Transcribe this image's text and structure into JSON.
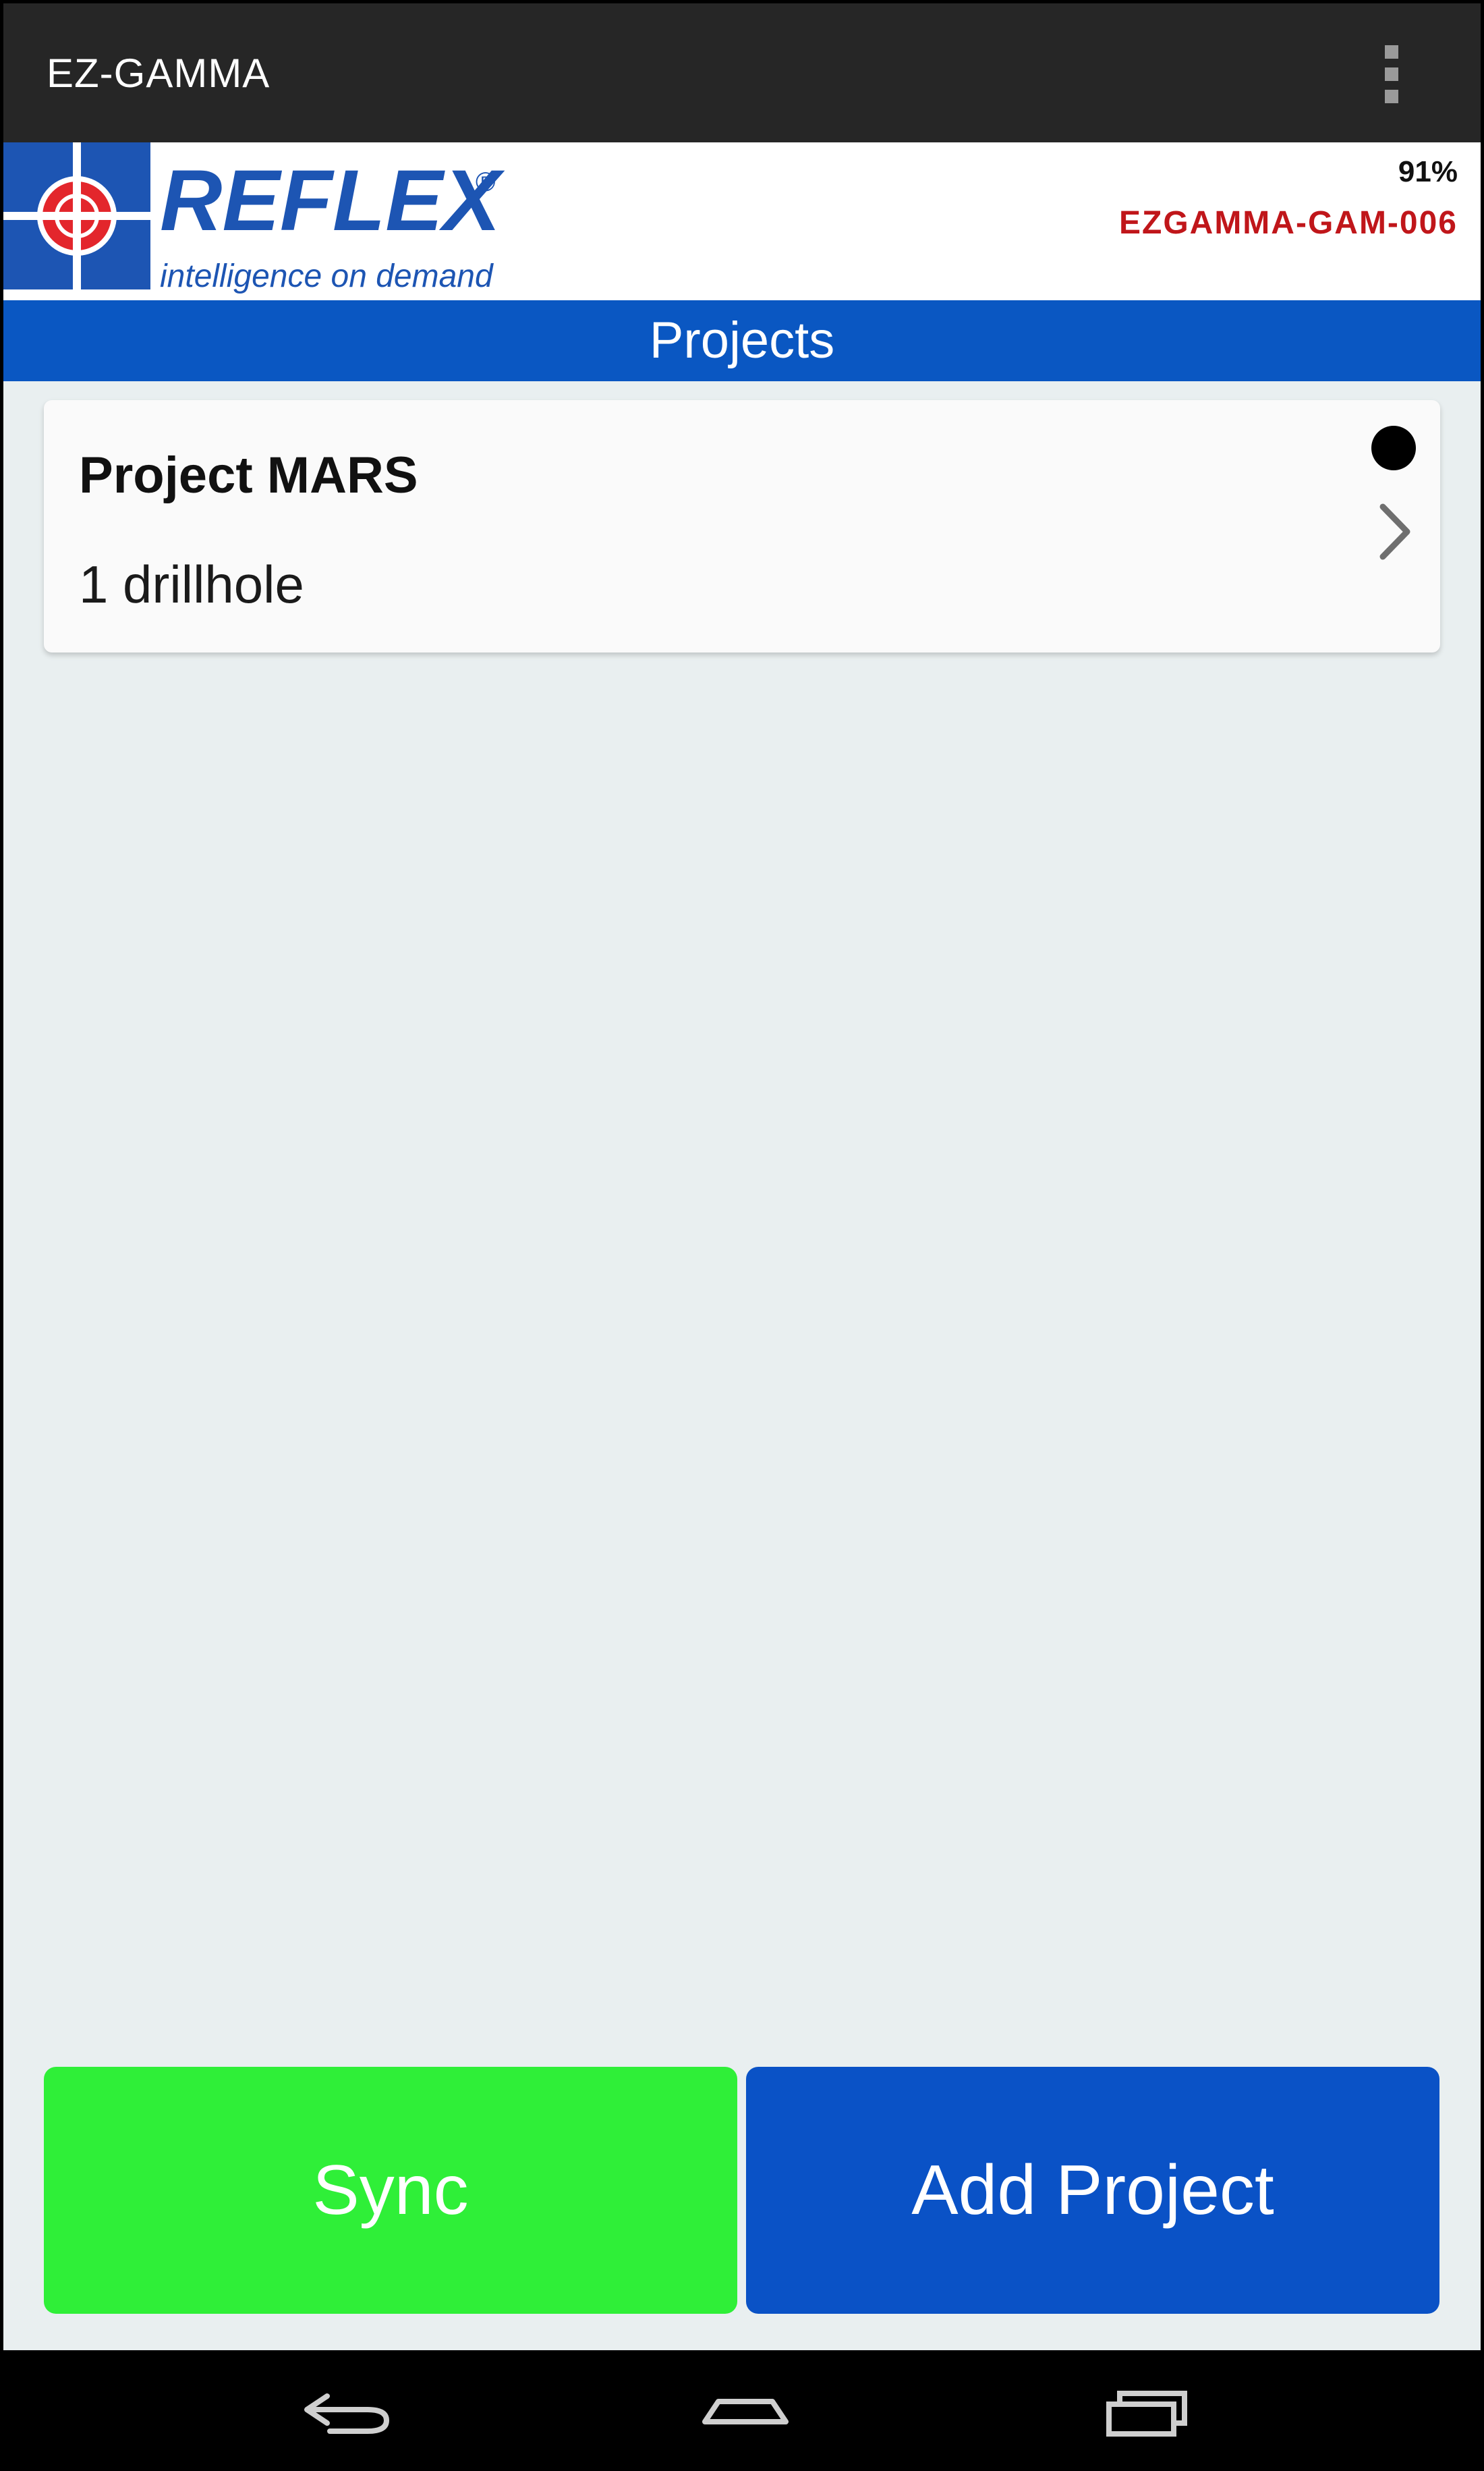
{
  "app": {
    "title": "EZ-GAMMA"
  },
  "header": {
    "logo": {
      "brand": "REFLEX",
      "tagline": "intelligence on demand",
      "registered_mark": "®"
    },
    "battery": "91%",
    "device_id": "EZGAMMA-GAM-006"
  },
  "section": {
    "title": "Projects"
  },
  "projects": [
    {
      "name": "Project MARS",
      "subtitle": "1 drillhole"
    }
  ],
  "buttons": {
    "sync": "Sync",
    "add_project": "Add Project"
  },
  "colors": {
    "action_bar": "#262626",
    "accent_blue": "#0a57c2",
    "sync_green": "#2fef38",
    "add_blue": "#0a52c6",
    "device_id_red": "#c0161a",
    "logo_red": "#e3262c",
    "background": "#e9eff0"
  },
  "icons": {
    "overflow": "overflow-menu-icon",
    "chevron": "chevron-right-icon",
    "status": "status-dot-icon",
    "back": "back-icon",
    "home": "home-icon",
    "recents": "recent-apps-icon"
  }
}
